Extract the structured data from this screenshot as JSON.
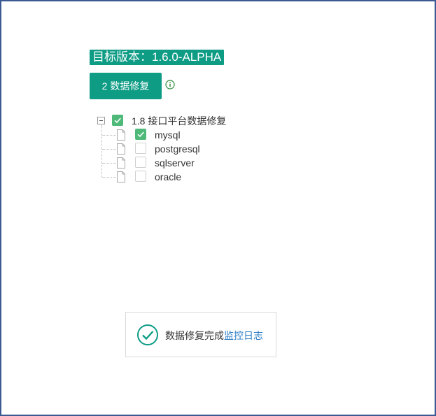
{
  "header": {
    "version_title": "目标版本：1.6.0-ALPHA",
    "repair_button_label": "2 数据修复"
  },
  "tree": {
    "root": {
      "label": "1.8 接口平台数据修复",
      "checked": true,
      "expanded": true
    },
    "children": [
      {
        "label": "mysql",
        "checked": true
      },
      {
        "label": "postgresql",
        "checked": false
      },
      {
        "label": "sqlserver",
        "checked": false
      },
      {
        "label": "oracle",
        "checked": false
      }
    ]
  },
  "toast": {
    "message": "数据修复完成",
    "link_label": "监控日志"
  },
  "colors": {
    "primary": "#0e9c85",
    "checkbox_checked": "#4fb97a",
    "link": "#2a7cc7",
    "frame_border": "#3b5a94"
  },
  "icons": {
    "info": "info-icon",
    "file": "file-icon",
    "success": "check-circle-icon",
    "collapse": "minus-square-icon"
  }
}
